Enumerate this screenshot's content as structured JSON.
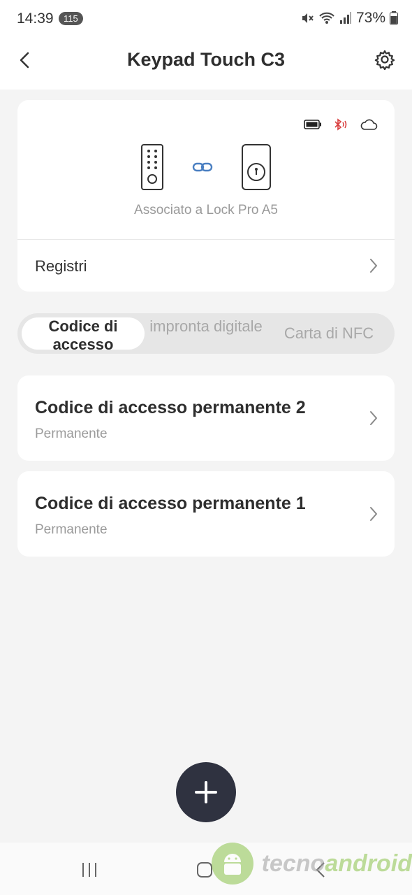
{
  "status_bar": {
    "time": "14:39",
    "notification_count": "115",
    "battery": "73%",
    "icons": [
      "mute-icon",
      "wifi-icon",
      "signal-icon",
      "battery-icon"
    ]
  },
  "header": {
    "title": "Keypad Touch C3",
    "back_icon": "chevron-left-icon",
    "settings_icon": "gear-icon"
  },
  "device_card": {
    "status_icons": [
      "battery-icon",
      "bluetooth-icon",
      "cloud-icon"
    ],
    "bluetooth_color": "#d94040",
    "associated_text": "Associato a Lock Pro A5",
    "link_color": "#4a7fc1",
    "registri_label": "Registri"
  },
  "tabs": [
    {
      "label": "Codice di accesso",
      "active": true
    },
    {
      "label": "impronta digitale",
      "active": false
    },
    {
      "label": "Carta di NFC",
      "active": false
    }
  ],
  "codes": [
    {
      "title": "Codice di accesso permanente 2",
      "subtitle": "Permanente"
    },
    {
      "title": "Codice di accesso permanente 1",
      "subtitle": "Permanente"
    }
  ],
  "fab": {
    "icon": "plus-icon",
    "color": "#2f3240"
  },
  "watermark": {
    "part1": "tecno",
    "part2": "android"
  }
}
